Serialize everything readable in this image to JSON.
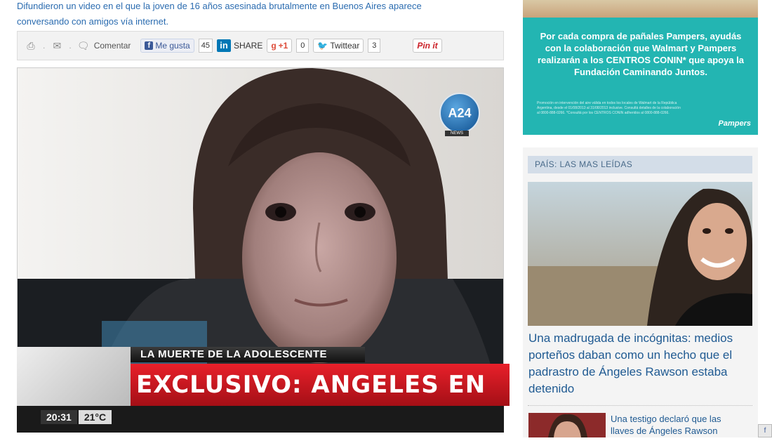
{
  "article": {
    "lede_line1": "Difundieron un video en el que la joven de 16 años asesinada brutalmente en Buenos Aires aparece",
    "lede_line2": "conversando con amigos vía internet."
  },
  "share_bar": {
    "print_icon": "printer-icon",
    "mail_icon": "envelope-icon",
    "comment_label": "Comentar",
    "facebook_label": "Me gusta",
    "facebook_count": "45",
    "linkedin_label": "SHARE",
    "gplus_label": "+1",
    "gplus_count": "0",
    "twitter_label": "Twittear",
    "twitter_count": "3",
    "pinterest_label": "Pin it"
  },
  "video": {
    "channel_logo": "A24",
    "channel_sub": "NEWS",
    "chyron_top": "LA MUERTE DE LA ADOLESCENTE",
    "chyron_main": "EXCLUSIVO: ANGELES EN UN CHAT",
    "time": "20:31",
    "temperature": "21°C"
  },
  "ad": {
    "text": "Por cada compra de pañales Pampers, ayudás con la colaboración que Walmart y Pampers realizarán a los CENTROS CONIN* que apoya la Fundación Caminando Juntos.",
    "fine_print": "Promoción en intervención del aire válida en todos los locales de Walmart de la República Argentina, desde el 01/08/2013 al 31/08/2013 inclusive. Consultá detalles de la colaboración al 0800-888-0266. *Consultá por los CENTROS CONIN adheridos al 0800-888-0266.",
    "brand": "Pampers"
  },
  "sidebar": {
    "section_title": "PAÍS: LAS MAS LEÍDAS",
    "featured_title": "Una madrugada de incógnitas: medios porteños daban como un hecho que el padrastro de Ángeles Rawson estaba detenido",
    "second_title": "Una testigo declaró que las llaves de Ángeles Rawson"
  },
  "colors": {
    "link_blue": "#1f5a92",
    "chyron_red": "#d81a24",
    "ad_teal": "#23b5b2"
  }
}
